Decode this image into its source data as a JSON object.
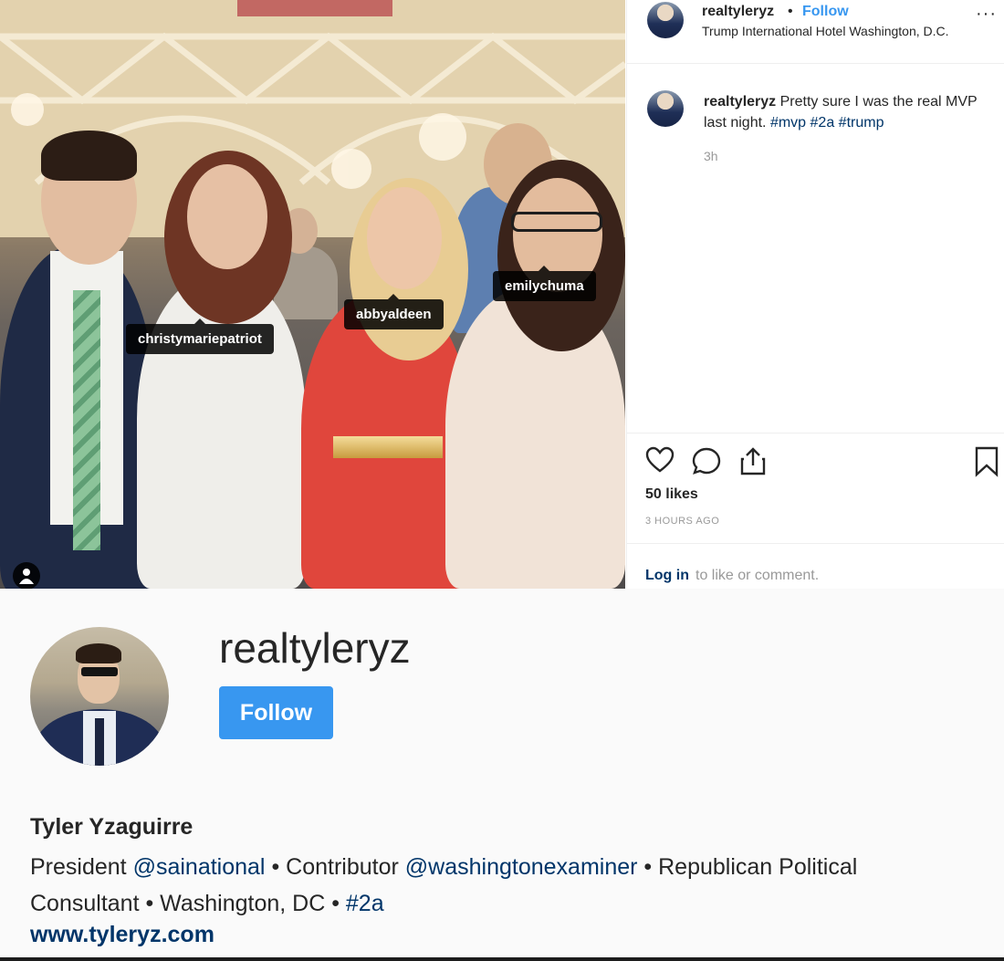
{
  "post": {
    "photo_tags": [
      "christymariepatriot",
      "abbyaldeen",
      "emilychuma"
    ],
    "header": {
      "username": "realtyleryz",
      "separator": "•",
      "follow_label": "Follow",
      "location": "Trump International Hotel Washington, D.C.",
      "more_icon": "more-icon"
    },
    "caption": {
      "username": "realtyleryz",
      "text": "Pretty sure I was the real MVP last night.",
      "hashtags": [
        "#mvp",
        "#2a",
        "#trump"
      ],
      "time": "3h"
    },
    "actions": {
      "icons": [
        "heart-icon",
        "comment-icon",
        "share-icon",
        "bookmark-icon"
      ],
      "likes": "50 likes",
      "posted": "3 HOURS AGO"
    },
    "login": {
      "link": "Log in",
      "rest": "to like or comment."
    }
  },
  "profile": {
    "username": "realtyleryz",
    "follow_label": "Follow",
    "full_name": "Tyler Yzaguirre",
    "bio": {
      "part1": "President",
      "mention1": "@sainational",
      "part2": "• Contributor",
      "mention2": "@washingtonexaminer",
      "part3": "• Republican Political",
      "line2": "Consultant • Washington, DC •",
      "hashtag": "#2a"
    },
    "website": "www.tyleryz.com"
  },
  "colors": {
    "accent": "#3897f0",
    "link": "#003569",
    "muted": "#999999"
  }
}
